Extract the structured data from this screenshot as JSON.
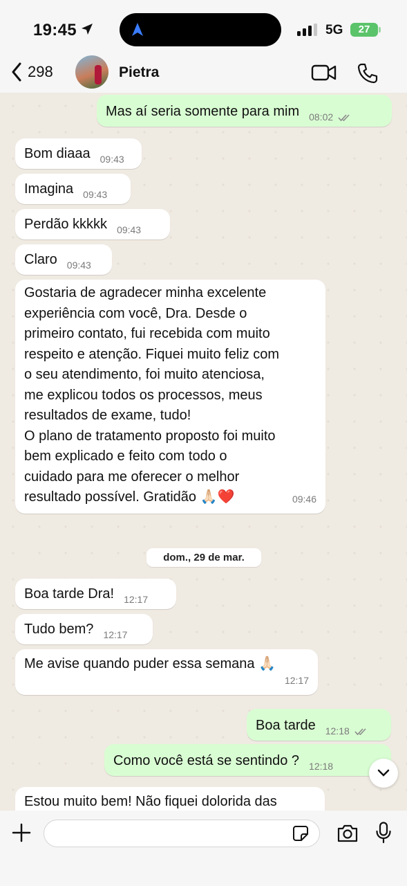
{
  "status_bar": {
    "time": "19:45",
    "network": "5G",
    "battery": "27"
  },
  "header": {
    "back_count": "298",
    "contact_name": "Pietra"
  },
  "messages_top": [
    {
      "text": "Mas aí seria somente para mim",
      "time": "08:02",
      "outgoing": true,
      "read": true
    },
    {
      "text": "Bom diaaa",
      "time": "09:43"
    },
    {
      "text": "Imagina",
      "time": "09:43"
    },
    {
      "text": "Perdão kkkkk",
      "time": "09:43"
    },
    {
      "text": "Claro",
      "time": "09:43"
    }
  ],
  "long_message": {
    "lines": [
      "Gostaria de agradecer minha excelente",
      "experiência com você, Dra. Desde o",
      "primeiro contato, fui recebida com muito",
      "respeito e atenção. Fiquei muito feliz com",
      "o seu atendimento, foi muito atenciosa,",
      "me explicou todos os processos, meus",
      "resultados de exame, tudo!",
      "O plano de tratamento proposto foi muito",
      "bem explicado e feito com todo o",
      "cuidado para me oferecer o melhor",
      "resultado possível. Gratidão 🙏🏻❤️"
    ],
    "time": "09:46"
  },
  "date_divider": "dom., 29 de mar.",
  "messages_bottom": [
    {
      "text": "Boa tarde Dra!",
      "time": "12:17"
    },
    {
      "text": "Tudo bem?",
      "time": "12:17"
    },
    {
      "text": "Me avise quando puder essa semana 🙏🏻",
      "time": "12:17"
    },
    {
      "text": "Boa tarde",
      "time": "12:18",
      "outgoing": true,
      "read": true
    },
    {
      "text": "Como você está se sentindo ?",
      "time": "12:18",
      "outgoing": true
    },
    {
      "text": "Estou muito bem! Não fiquei dolorida das",
      "time": ""
    }
  ],
  "composer": {
    "placeholder": ""
  },
  "colors": {
    "incoming": "#ffffff",
    "outgoing": "#d9fdd3",
    "background": "#efeae2",
    "read_ticks": "#53bdeb"
  },
  "icons": [
    "location-arrow-icon",
    "signal-icon",
    "back-chevron-icon",
    "video-call-icon",
    "phone-icon",
    "read-ticks-icon",
    "chevron-down-icon",
    "plus-icon",
    "sticker-icon",
    "camera-icon",
    "mic-icon"
  ]
}
